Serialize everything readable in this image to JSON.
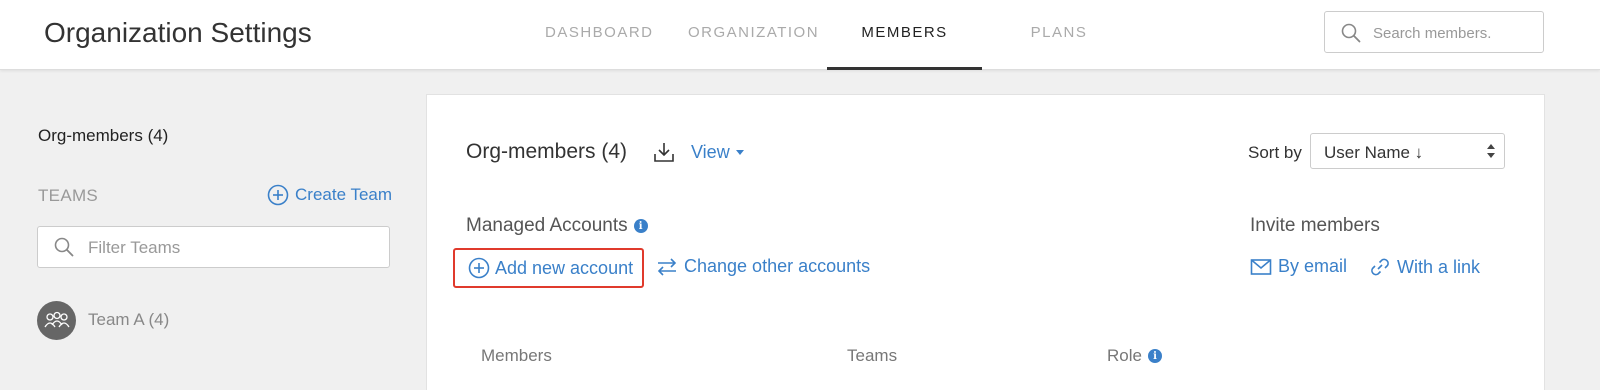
{
  "header": {
    "title": "Organization Settings",
    "tabs": [
      {
        "label": "DASHBOARD",
        "active": false
      },
      {
        "label": "ORGANIZATION",
        "active": false
      },
      {
        "label": "MEMBERS",
        "active": true
      },
      {
        "label": "PLANS",
        "active": false
      }
    ],
    "search": {
      "placeholder": "Search members.",
      "value": ""
    }
  },
  "sidebar": {
    "heading": "Org-members (4)",
    "teams_label": "TEAMS",
    "create_team_label": "Create Team",
    "filter": {
      "placeholder": "Filter Teams",
      "value": ""
    },
    "teams": [
      {
        "label": "Team A (4)",
        "icon": "group-icon"
      }
    ]
  },
  "main": {
    "title": "Org-members (4)",
    "view_label": "View",
    "sort": {
      "label": "Sort by",
      "value": "User Name ↓"
    },
    "managed_accounts": {
      "label": "Managed Accounts",
      "add_label": "Add new account",
      "change_label": "Change other accounts"
    },
    "invite": {
      "label": "Invite members",
      "email_label": "By email",
      "link_label": "With a link"
    },
    "columns": [
      "Members",
      "Teams",
      "Role"
    ]
  },
  "colors": {
    "accent": "#3a80c9",
    "highlight": "#e03a2c",
    "background": "#f0f0f0"
  }
}
